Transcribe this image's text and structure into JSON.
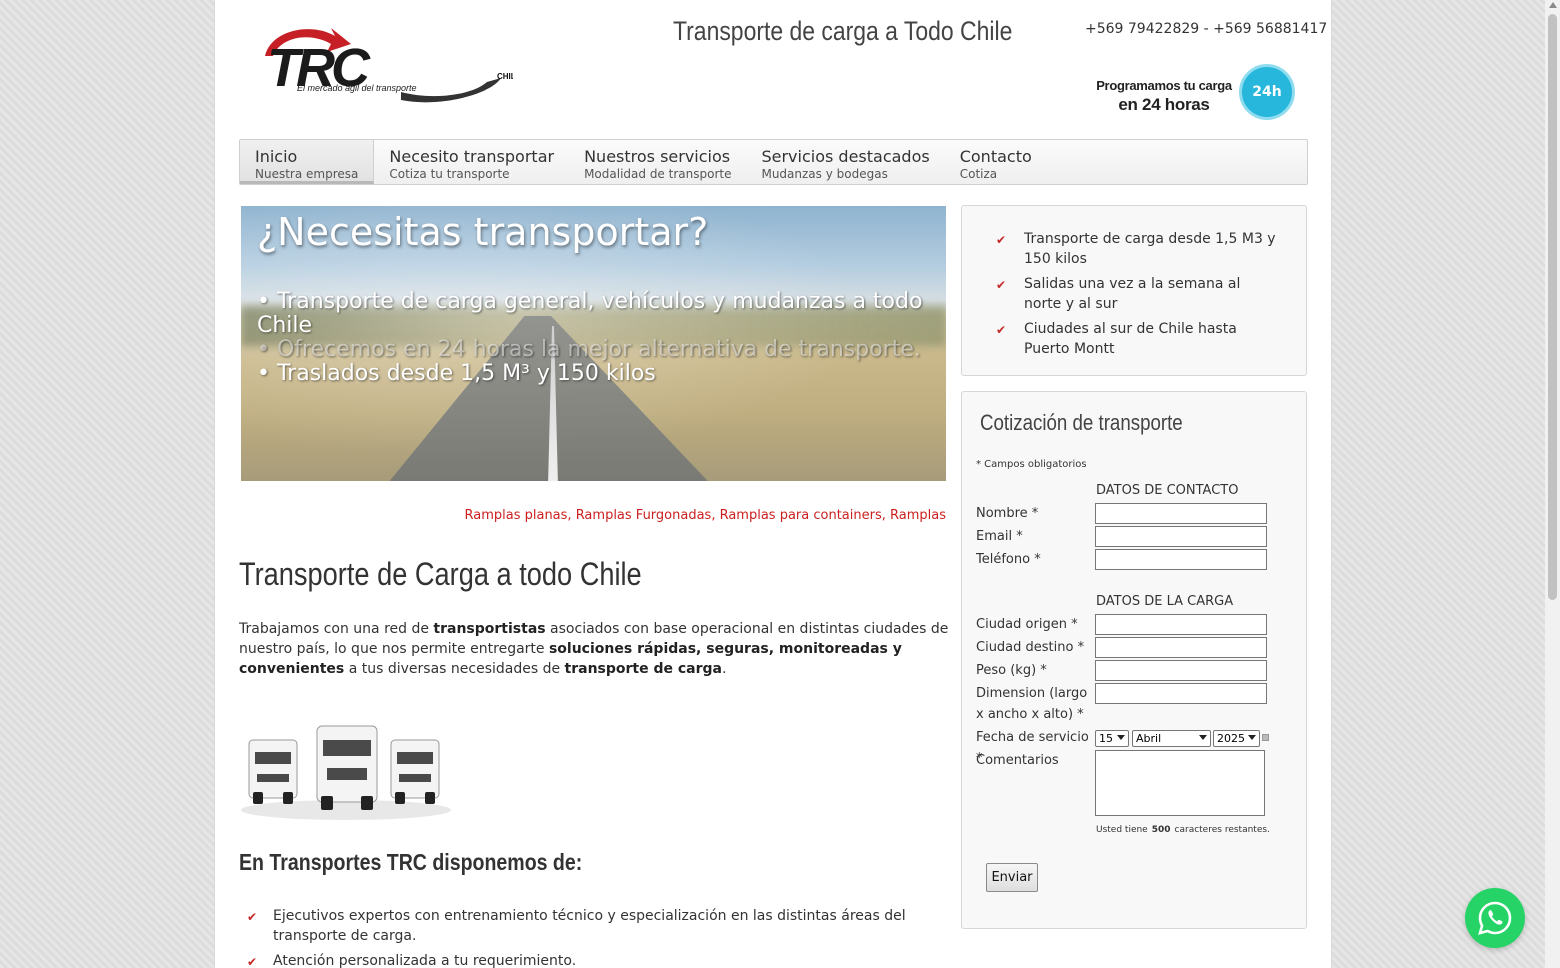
{
  "header": {
    "logo_text": "TRC",
    "logo_country": "CHILE",
    "logo_slogan": "El mercado ágil del transporte",
    "tagline": "Transporte de carga a Todo Chile",
    "phones": "+569 79422829 - +569 56881417",
    "promo_line1": "Programamos tu carga",
    "promo_line2": "en 24 horas",
    "promo_badge": "24h"
  },
  "nav": [
    {
      "title": "Inicio",
      "sub": "Nuestra empresa",
      "active": true
    },
    {
      "title": "Necesito transportar",
      "sub": "Cotiza tu transporte"
    },
    {
      "title": "Nuestros servicios",
      "sub": "Modalidad de transporte"
    },
    {
      "title": "Servicios destacados",
      "sub": "Mudanzas y bodegas"
    },
    {
      "title": "Contacto",
      "sub": "Cotiza"
    }
  ],
  "hero": {
    "title": "¿Necesitas transportar?",
    "line1": "• Transporte de carga general, vehículos y mudanzas a todo Chile",
    "line2": "• Ofrecemos en 24 horas la mejor alternativa de transporte.",
    "line3": "• Traslados desde 1,5 M³ y 150 kilos"
  },
  "tags": [
    "Ramplas planas",
    "Ramplas Furgonadas",
    "Ramplas para containers",
    "Ramplas"
  ],
  "main": {
    "heading": "Transporte de Carga a todo Chile",
    "para_1": "Trabajamos con una red de ",
    "para_b1": "transportistas",
    "para_2": " asociados con base operacional en distintas ciudades de nuestro país, lo que nos permite entregarte ",
    "para_b2": "soluciones rápidas, seguras, monitoreadas y convenientes",
    "para_3": " a tus diversas necesidades de ",
    "para_b3": "transporte de carga",
    "para_4": ".",
    "subheading": "En Transportes TRC disponemos de:",
    "features": [
      "Ejecutivos expertos con entrenamiento técnico y especialización en las distintas áreas del transporte de carga.",
      "Atención personalizada a tu requerimiento."
    ]
  },
  "sidebar": {
    "highlights": [
      "Transporte de carga desde 1,5 M3 y 150 kilos",
      "Salidas una vez a la semana al norte y al sur",
      "Ciudades al sur de Chile hasta Puerto Montt"
    ]
  },
  "form": {
    "title": "Cotización de transporte",
    "required_note": "* Campos obligatorios",
    "section_contact": "DATOS DE CONTACTO",
    "nombre_label": "Nombre *",
    "email_label": "Email *",
    "telefono_label": "Teléfono *",
    "section_cargo": "DATOS DE LA CARGA",
    "origen_label": "Ciudad origen *",
    "destino_label": "Ciudad destino *",
    "peso_label": "Peso (kg) *",
    "dimension_label": "Dimension (largo x ancho x alto) *",
    "fecha_label": "Fecha de servicio *",
    "day": "15",
    "month": "Abril",
    "year": "2025",
    "comentarios_label": "Comentarios",
    "chars_pre": "Usted tiene",
    "chars_count": "500",
    "chars_post": "caracteres restantes.",
    "submit": "Enviar"
  },
  "colors": {
    "accent_red": "#c62828",
    "whatsapp_green": "#25d366",
    "badge_blue": "#27b6dc"
  },
  "icons": {
    "check": "check-icon",
    "whatsapp": "whatsapp-icon",
    "calendar": "calendar-icon"
  }
}
